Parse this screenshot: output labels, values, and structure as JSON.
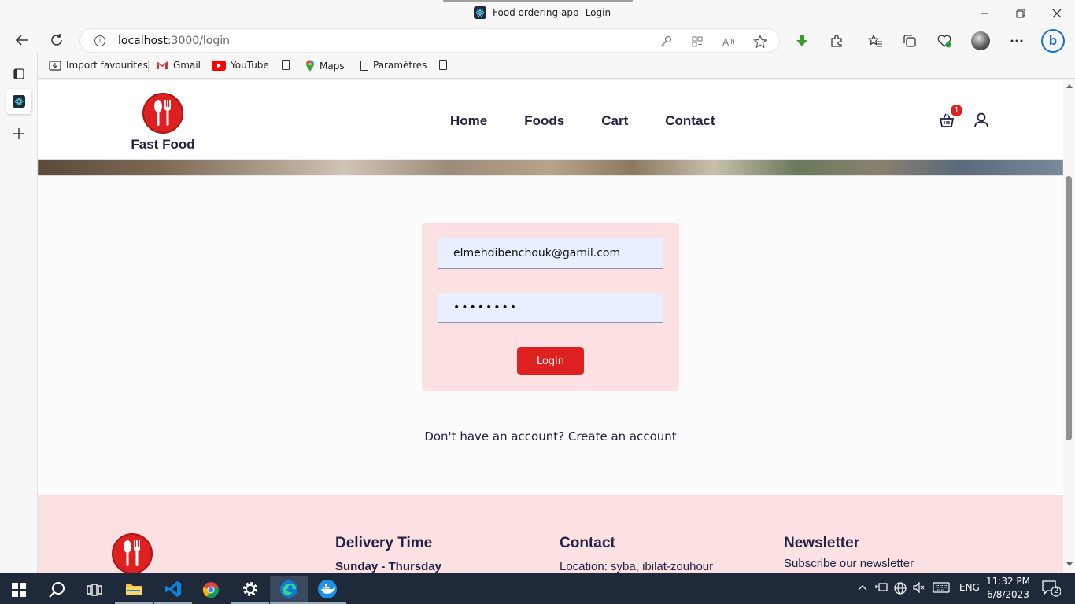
{
  "window": {
    "title": "Food ordering app -Login",
    "controls": [
      "minimize",
      "maximize",
      "close"
    ]
  },
  "browser": {
    "url_host": "localhost",
    "url_path": ":3000/login",
    "favourites": [
      {
        "label": "Import favourites",
        "icon": "import-icon"
      },
      {
        "label": "Gmail",
        "icon": "gmail-icon"
      },
      {
        "label": "YouTube",
        "icon": "youtube-icon"
      },
      {
        "label": "",
        "icon": "page-icon"
      },
      {
        "label": "Maps",
        "icon": "maps-icon"
      },
      {
        "label": "Paramètres",
        "icon": "page-icon"
      },
      {
        "label": "",
        "icon": "page-icon"
      }
    ]
  },
  "site": {
    "brand": "Fast Food",
    "nav": [
      "Home",
      "Foods",
      "Cart",
      "Contact"
    ],
    "cart_count": "1"
  },
  "login": {
    "email_value": "elmehdibenchouk@gamil.com",
    "password_mask": "••••••••",
    "button": "Login",
    "signup_text": "Don't have an account? Create an account"
  },
  "footer": {
    "delivery": {
      "title": "Delivery Time",
      "line1": "Sunday - Thursday"
    },
    "contact": {
      "title": "Contact",
      "line1": "Location: syba, ibilat-zouhour"
    },
    "newsletter": {
      "title": "Newsletter",
      "line1": "Subscribe our newsletter"
    }
  },
  "taskbar": {
    "lang": "ENG",
    "time": "11:32 PM",
    "date": "6/8/2023",
    "notifications": "2"
  },
  "colors": {
    "brand_red": "#df2020",
    "navy": "#212245",
    "pink_bg": "#fbe1e1"
  }
}
